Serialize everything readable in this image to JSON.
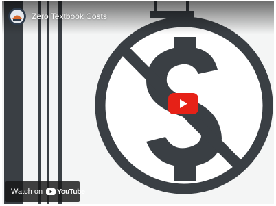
{
  "video": {
    "title": "Zero Textbook Costs"
  },
  "player": {
    "watch_on_label": "Watch on",
    "platform_name": "YouTube"
  },
  "icons": {
    "channel": "channel-avatar",
    "play": "play-icon",
    "youtube": "youtube-logo-icon"
  },
  "colors": {
    "illustration_dark": "#3a3f44",
    "illustration_bg": "#f4f5f5",
    "play_red": "#e62117",
    "overlay_dark": "#171717"
  }
}
